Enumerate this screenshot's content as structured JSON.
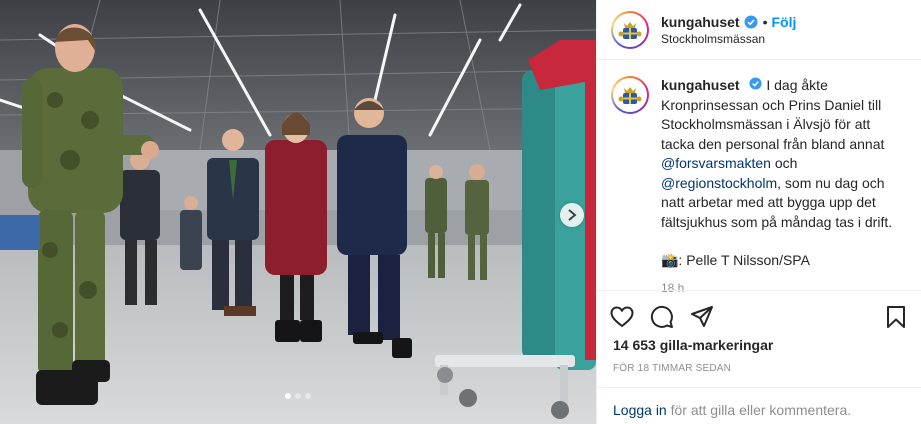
{
  "header": {
    "username": "kungahuset",
    "separator": "•",
    "follow_label": "Följ",
    "location": "Stockholmsmässan"
  },
  "caption": {
    "username": "kungahuset",
    "text_part1": "I dag åkte Kronprinsessan och Prins Daniel till Stockholmsmässan i Älvsjö för att tacka den personal från bland annat",
    "mention1": "@forsvarsmakten",
    "text_part2": "och",
    "mention2": "@regionstockholm",
    "text_part3": ", som nu dag och natt arbetar med att bygga upp det fältsjukhus som på måndag tas i drift.",
    "credit": "📸: Pelle T Nilsson/SPA",
    "time": "18 h"
  },
  "actions": {
    "likes": "14 653 gilla-markeringar",
    "posted_ago": "FÖR 18 TIMMAR SEDAN"
  },
  "login": {
    "link": "Logga in",
    "rest": " för att gilla eller kommentera."
  },
  "carousel": {
    "total": 3,
    "active_index": 1
  },
  "colors": {
    "link_blue": "#0095f6",
    "mention_blue": "#00376b",
    "verified_blue": "#3897f0",
    "muted_gray": "#8e8e8e"
  },
  "icons": [
    "verified-icon",
    "heart-icon",
    "comment-icon",
    "share-icon",
    "bookmark-icon",
    "chevron-right-icon",
    "royal-crest-icon"
  ]
}
